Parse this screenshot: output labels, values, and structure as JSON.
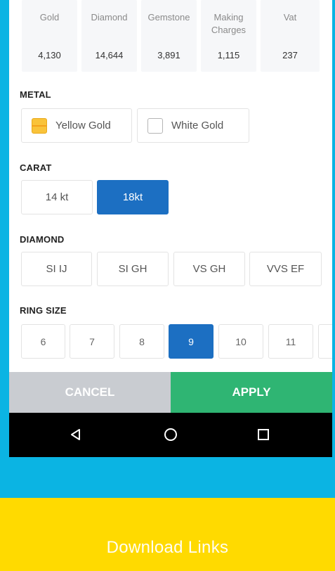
{
  "price_breakdown": [
    {
      "label": "Gold",
      "value": "4,130"
    },
    {
      "label": "Diamond",
      "value": "14,644"
    },
    {
      "label": "Gemstone",
      "value": "3,891"
    },
    {
      "label": "Making Charges",
      "value": "1,115"
    },
    {
      "label": "Vat",
      "value": "237"
    }
  ],
  "metal": {
    "title": "METAL",
    "options": [
      {
        "label": "Yellow Gold",
        "swatch_color": "#F9C33A"
      },
      {
        "label": "White Gold",
        "swatch_color": "#FFFFFF"
      }
    ]
  },
  "carat": {
    "title": "CARAT",
    "options": [
      "14 kt",
      "18kt"
    ],
    "selected": "18kt"
  },
  "diamond": {
    "title": "DIAMOND",
    "options": [
      "SI IJ",
      "SI GH",
      "VS GH",
      "VVS EF"
    ]
  },
  "ring_size": {
    "title": "RING SIZE",
    "options": [
      "6",
      "7",
      "8",
      "9",
      "10",
      "11"
    ],
    "selected": "9"
  },
  "actions": {
    "cancel": "CANCEL",
    "apply": "APPLY"
  },
  "navbar": {
    "icons": [
      "back-icon",
      "home-icon",
      "recents-icon"
    ]
  },
  "footer": {
    "download_text": "Download Links"
  },
  "colors": {
    "background": "#0BB4E3",
    "selected": "#1C6FC2",
    "apply": "#2FB573",
    "cancel": "#C9CCD1",
    "footer": "#FFDA00"
  }
}
